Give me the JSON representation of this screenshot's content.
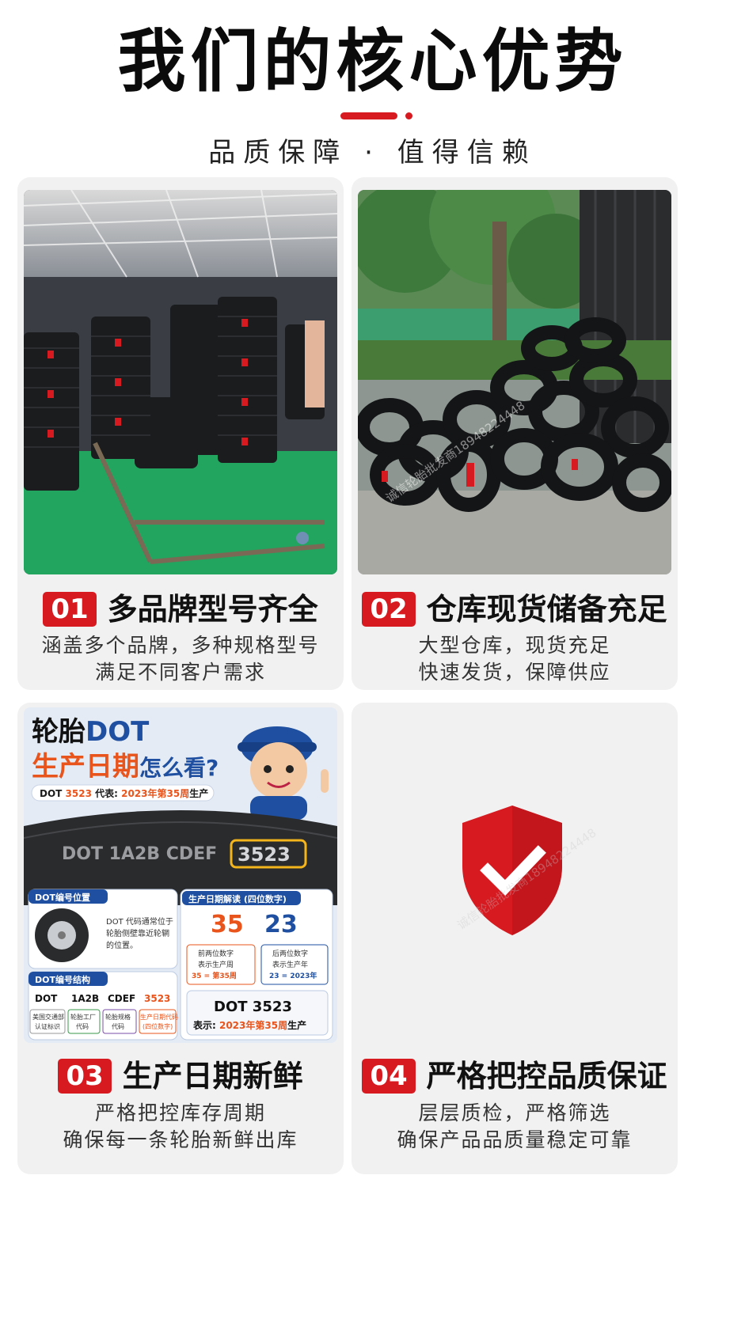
{
  "header": {
    "title": "我们的核心优势",
    "subtitle": "品质保障 · 值得信赖"
  },
  "colors": {
    "accent": "#d71920",
    "card_bg": "#f1f1f1",
    "dot_blue": "#1e4fa0",
    "dot_orange": "#e8541b"
  },
  "features": [
    {
      "num": "01",
      "title": "多品牌型号齐全",
      "lines": [
        "涵盖多个品牌，多种规格型号",
        "满足不同客户需求"
      ],
      "image": "warehouse-tire-stacks-photo"
    },
    {
      "num": "02",
      "title": "仓库现货储备充足",
      "lines": [
        "大型仓库，现货充足",
        "快速发货，保障供应"
      ],
      "image": "outdoor-tire-pile-photo"
    },
    {
      "num": "03",
      "title": "生产日期新鲜",
      "lines": [
        "严格把控库存周期",
        "确保每一条轮胎新鲜出库"
      ],
      "image": "dot-infographic"
    },
    {
      "num": "04",
      "title": "严格把控品质保证",
      "lines": [
        "层层质检，严格筛选",
        "确保产品品质量稳定可靠"
      ],
      "image": "shield-check-icon"
    }
  ],
  "watermark": "诚信轮胎批发商18948224448",
  "dot_infographic": {
    "heading1_a": "轮胎",
    "heading1_b": "DOT",
    "heading2_a": "生产日期",
    "heading2_b": "怎么看?",
    "example_a": "DOT ",
    "example_code": "3523",
    "example_b": " 代表: ",
    "example_c": "2023年第35周",
    "example_d": "生产",
    "sidewall_text": "DOT  1A2B  CDEF",
    "sidewall_code": "3523",
    "position_title": "DOT编号位置",
    "position_desc": [
      "DOT 代码通常位于",
      "轮胎侧壁靠近轮辋",
      "的位置。"
    ],
    "structure_title": "DOT编号结构",
    "structure": [
      {
        "code": "DOT",
        "label": [
          "美国交通部",
          "认证标识"
        ]
      },
      {
        "code": "1A2B",
        "label": [
          "轮胎工厂",
          "代码"
        ]
      },
      {
        "code": "CDEF",
        "label": [
          "轮胎规格",
          "代码"
        ]
      },
      {
        "code": "3523",
        "label": [
          "生产日期代码",
          "(四位数字)"
        ]
      }
    ],
    "decode_title": "生产日期解读 (四位数字)",
    "week_num": "35",
    "year_num": "23",
    "week_desc": [
      "前两位数字",
      "表示生产周",
      "35 = 第35周"
    ],
    "year_desc": [
      "后两位数字",
      "表示生产年",
      "23 = 2023年"
    ],
    "summary_code": "DOT 3523",
    "summary_a": "表示: ",
    "summary_b": "2023年第35周",
    "summary_c": "生产"
  }
}
